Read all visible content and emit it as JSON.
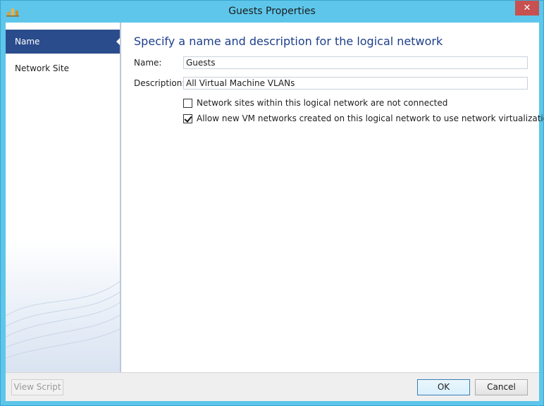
{
  "window": {
    "title": "Guests Properties",
    "close_symbol": "✕",
    "app_icon": "vmm-app-icon"
  },
  "sidebar": {
    "items": [
      {
        "label": "Name",
        "active": true
      },
      {
        "label": "Network Site",
        "active": false
      }
    ]
  },
  "main": {
    "heading": "Specify a name and description for the logical network",
    "name_label": "Name:",
    "name_value": "Guests",
    "description_label": "Description:",
    "description_value": "All Virtual Machine VLANs",
    "checkboxes": [
      {
        "label": "Network sites within this logical network are not connected",
        "checked": false
      },
      {
        "label": "Allow new VM networks created on this logical network to use network virtualization",
        "checked": true
      }
    ]
  },
  "footer": {
    "view_script_label": "View Script",
    "ok_label": "OK",
    "cancel_label": "Cancel"
  },
  "colors": {
    "titlebar": "#5ec6ea",
    "close_button": "#c75050",
    "nav_active": "#2b4c8c",
    "heading": "#1d3e8a"
  }
}
